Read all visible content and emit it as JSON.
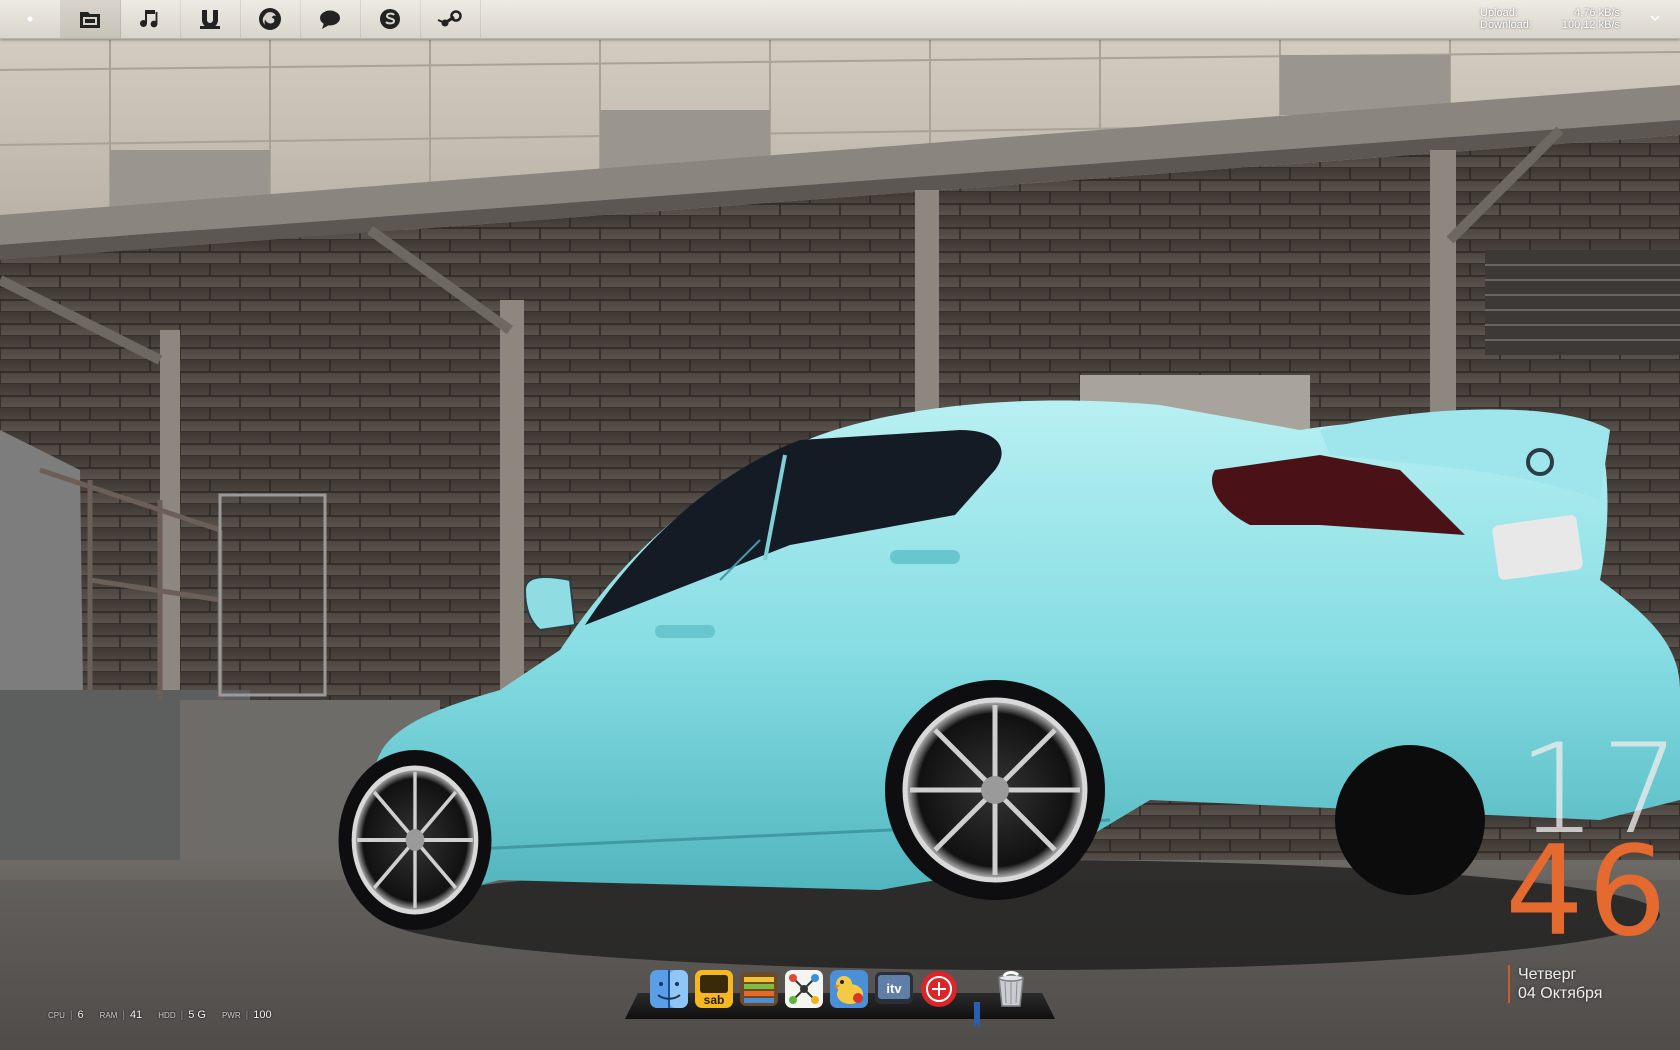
{
  "topbar": {
    "buttons": [
      {
        "name": "menu-dot-icon"
      },
      {
        "name": "home-folder-icon"
      },
      {
        "name": "music-note-icon"
      },
      {
        "name": "utorrent-icon"
      },
      {
        "name": "firefox-icon"
      },
      {
        "name": "chat-bubble-icon"
      },
      {
        "name": "skype-icon"
      },
      {
        "name": "steam-icon"
      }
    ],
    "network": {
      "upload_label": "Upload:",
      "upload_value": "4,76 kB/s",
      "download_label": "Download:",
      "download_value": "100,12 kB/s"
    }
  },
  "clock": {
    "hour": "17",
    "minute": "46",
    "weekday": "Четверг",
    "date": "04 Октября",
    "hour_color": "#ececec",
    "minute_color": "#e46a2f"
  },
  "system_stats": [
    {
      "label": "CPU",
      "value": "6"
    },
    {
      "label": "RAM",
      "value": "41"
    },
    {
      "label": "HDD",
      "value": "5 G"
    },
    {
      "label": "PWR",
      "value": "100"
    }
  ],
  "dock": {
    "items": [
      {
        "name": "finder-icon"
      },
      {
        "name": "sabnzbd-icon"
      },
      {
        "name": "stacks-icon"
      },
      {
        "name": "mindnode-icon"
      },
      {
        "name": "cyberduck-icon"
      },
      {
        "name": "itv-icon"
      },
      {
        "name": "scrobbler-icon"
      },
      {
        "name": "trash-icon"
      }
    ]
  }
}
